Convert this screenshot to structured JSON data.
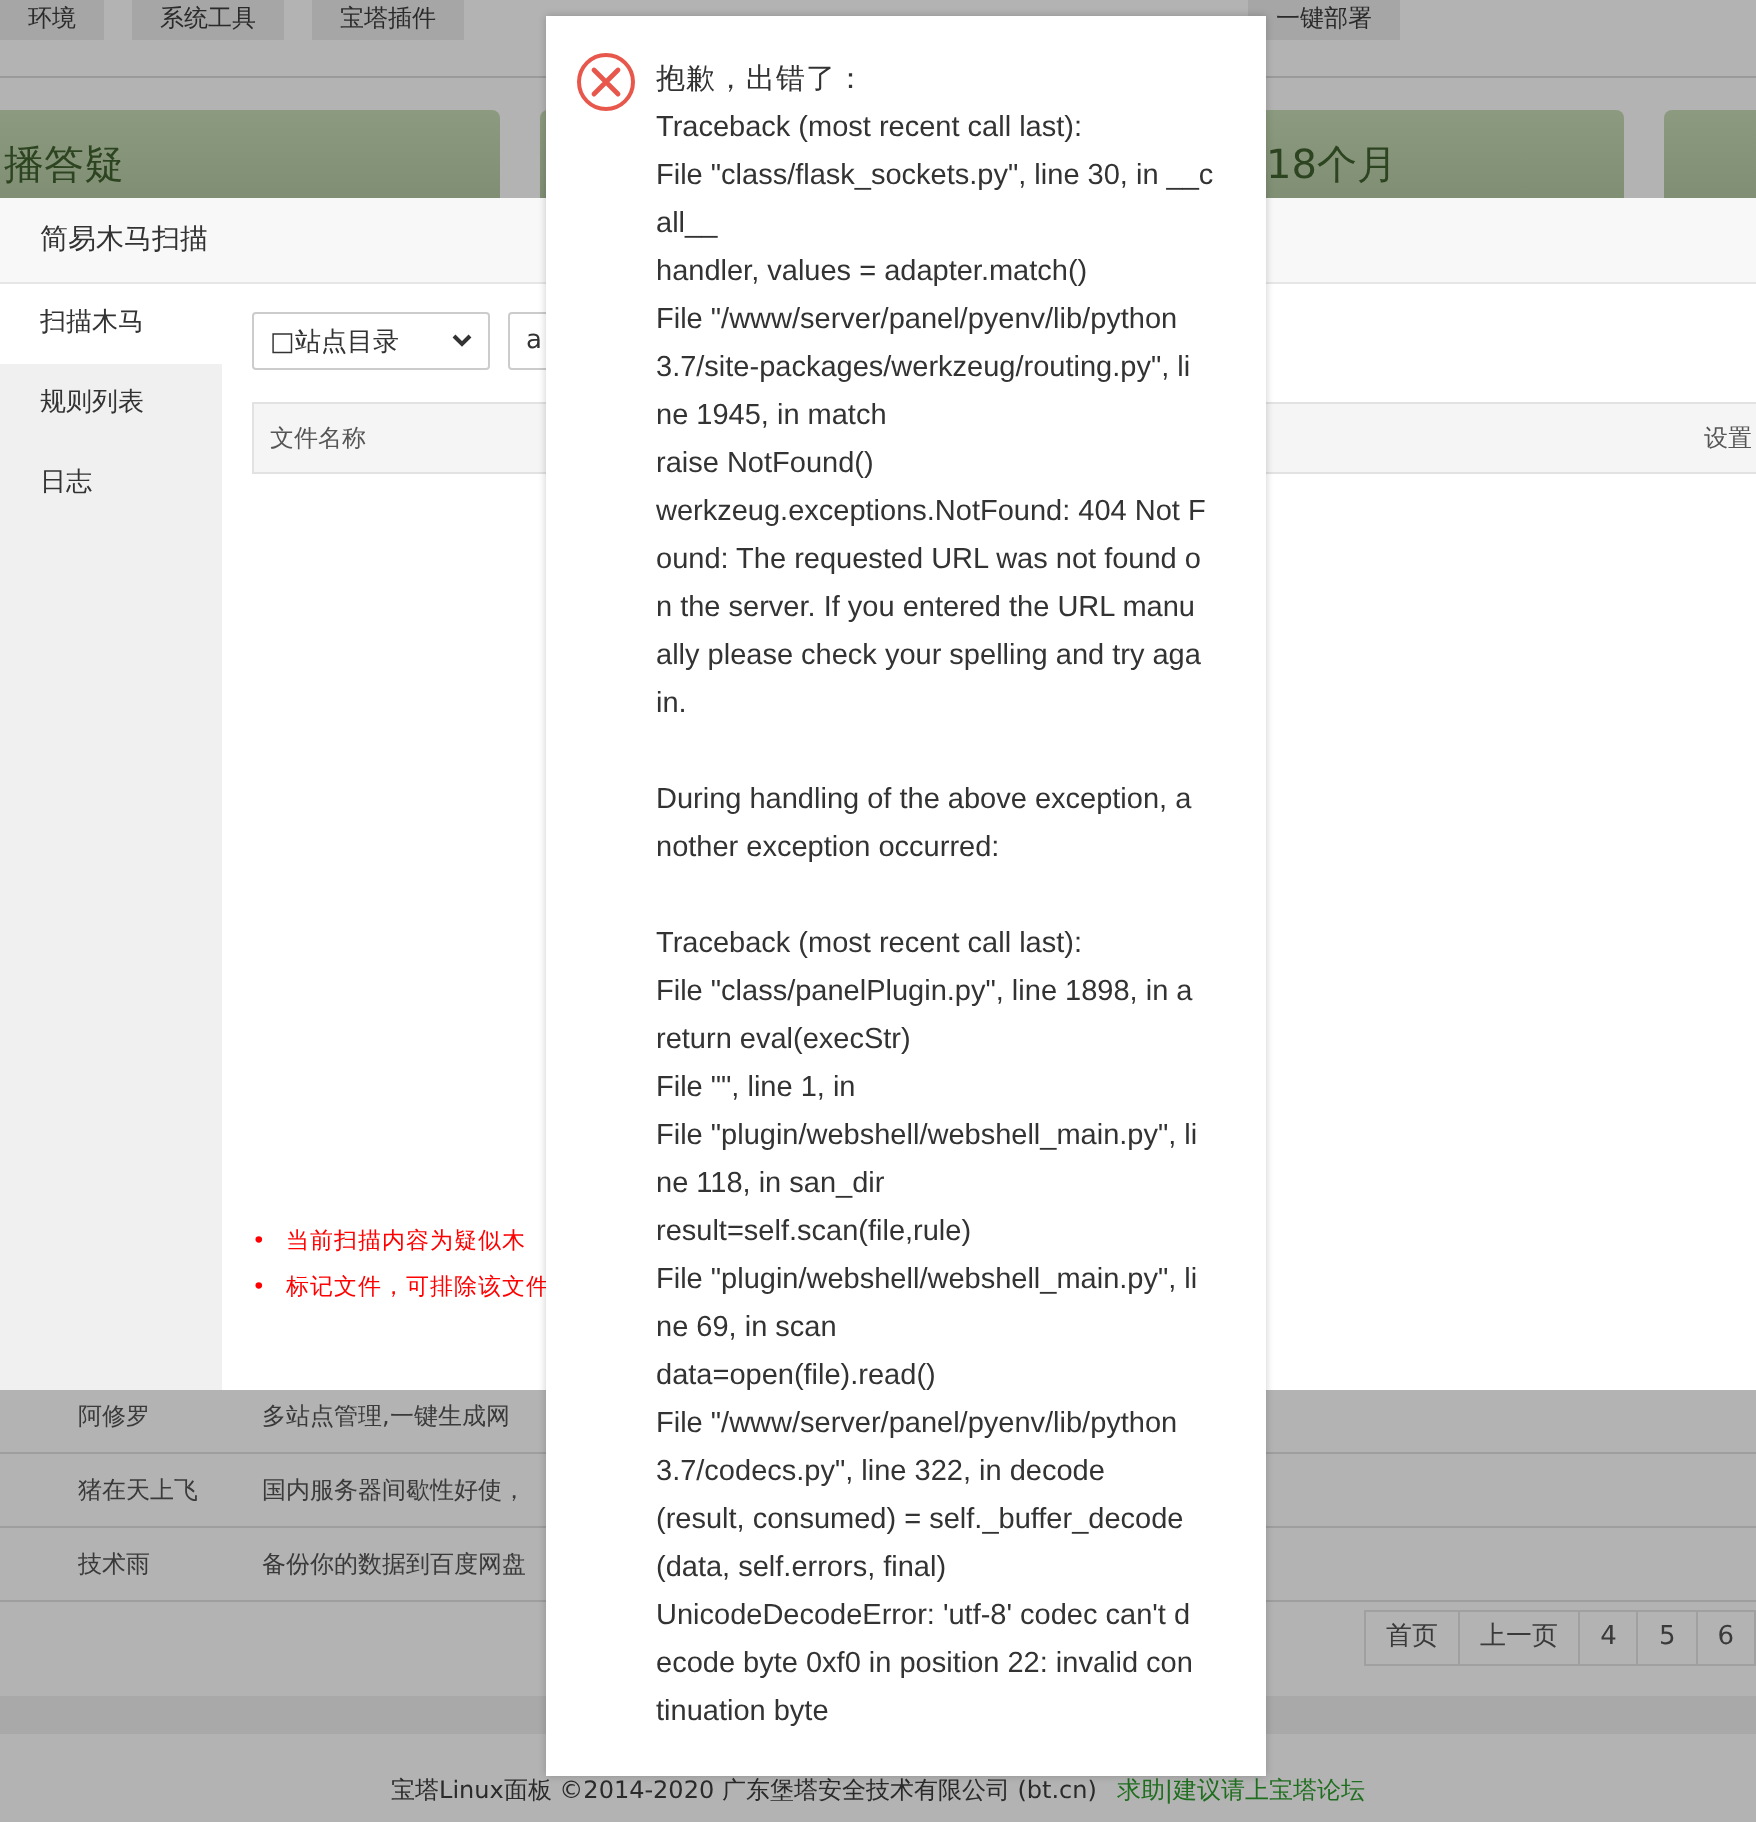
{
  "nav_tabs": [
    "环境",
    "系统工具",
    "宝塔插件",
    "一键部署"
  ],
  "cards": [
    {
      "kind": "text",
      "title": "播答疑"
    },
    {
      "kind": "text",
      "title": "18个月"
    },
    {
      "kind": "blank"
    }
  ],
  "plugin_rows": [
    {
      "author": "阿修罗",
      "description": "多站点管理,一键生成网"
    },
    {
      "author": "猪在天上飞",
      "description": "国内服务器间歇性好使，"
    },
    {
      "author": "技术雨",
      "description": "备份你的数据到百度网盘"
    }
  ],
  "pagination": [
    "首页",
    "上一页",
    "4",
    "5",
    "6"
  ],
  "footer": {
    "copyright": "宝塔Linux面板 ©2014-2020 广东堡塔安全技术有限公司 (bt.cn)",
    "link": "求助|建议请上宝塔论坛"
  },
  "dialog": {
    "title": "简易木马扫描",
    "menu": [
      {
        "label": "扫描木马",
        "selected": true
      },
      {
        "label": "规则列表",
        "selected": false
      },
      {
        "label": "日志",
        "selected": false
      }
    ],
    "directory_select": "□站点目录",
    "path_field": "a",
    "table_columns": [
      "文件名称",
      "设置"
    ],
    "notes": [
      {
        "bullet": "•",
        "text": "当前扫描内容为疑似木"
      },
      {
        "bullet": "•",
        "text": "标记文件，可排除该文件"
      }
    ]
  },
  "error": {
    "title": "抱歉，出错了：",
    "paragraphs": [
      [
        "Traceback (most recent call last):",
        "File \"class/flask_sockets.py\", line 30, in __c",
        "all__",
        "handler, values = adapter.match()",
        "File \"/www/server/panel/pyenv/lib/python",
        "3.7/site-packages/werkzeug/routing.py\", li",
        "ne 1945, in match",
        "raise NotFound()",
        "werkzeug.exceptions.NotFound: 404 Not F",
        "ound: The requested URL was not found o",
        "n the server. If you entered the URL manu",
        "ally please check your spelling and try aga",
        "in."
      ],
      [
        "During handling of the above exception, a",
        "nother exception occurred:"
      ],
      [
        "Traceback (most recent call last):",
        "File \"class/panelPlugin.py\", line 1898, in a",
        "return eval(execStr)",
        "File \"\", line 1, in",
        "File \"plugin/webshell/webshell_main.py\", li",
        "ne 118, in san_dir",
        "result=self.scan(file,rule)",
        "File \"plugin/webshell/webshell_main.py\", li",
        "ne 69, in scan",
        "data=open(file).read()",
        "File \"/www/server/panel/pyenv/lib/python",
        "3.7/codecs.py\", line 322, in decode",
        "(result, consumed) = self._buffer_decode",
        "(data, self.errors, final)",
        "UnicodeDecodeError: 'utf-8' codec can't d",
        "ecode byte 0xf0 in position 22: invalid con",
        "tinuation byte"
      ]
    ]
  }
}
